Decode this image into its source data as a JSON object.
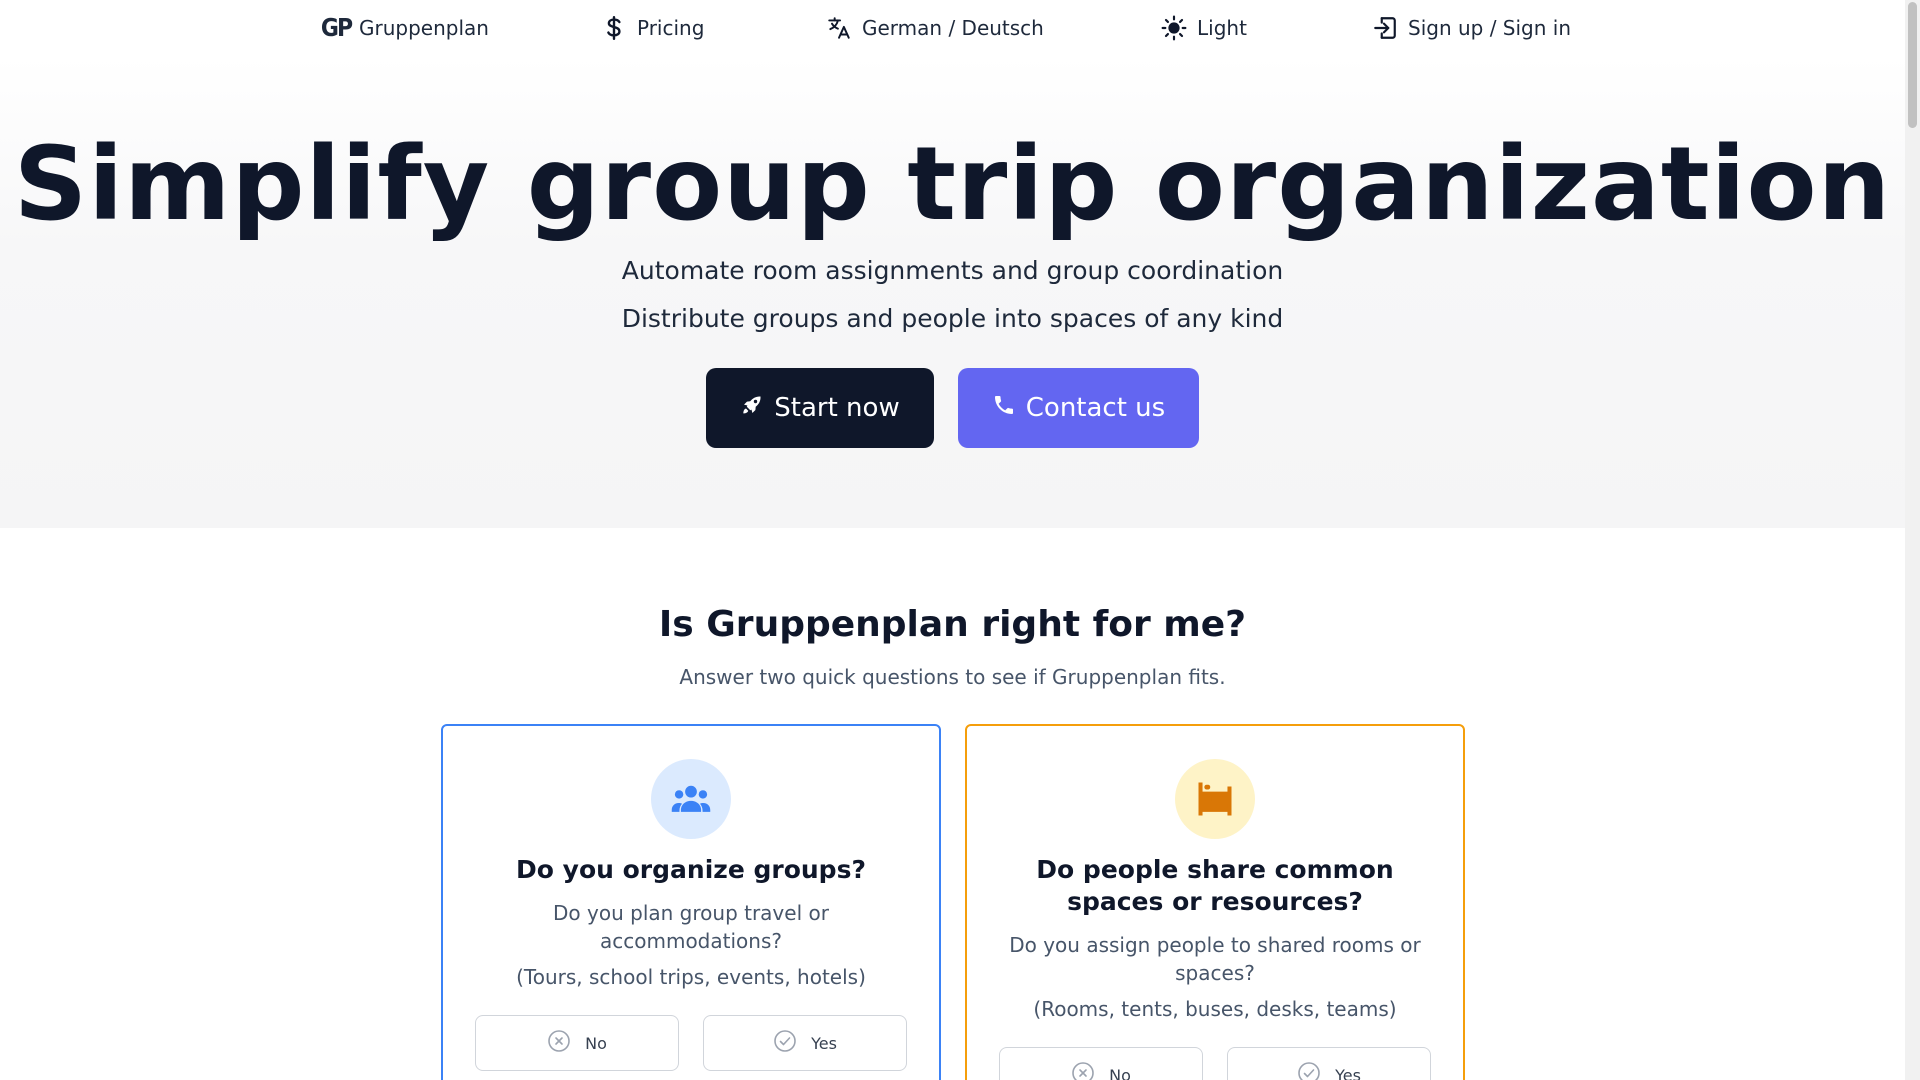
{
  "nav": {
    "brand": "Gruppenplan",
    "logo_mark": "GP",
    "pricing": "Pricing",
    "language": "German / Deutsch",
    "theme": "Light",
    "auth": "Sign up / Sign in"
  },
  "hero": {
    "title": "Simplify group trip organization",
    "subtitle_1": "Automate room assignments and group coordination",
    "subtitle_2": "Distribute groups and people into spaces of any kind",
    "start_label": "Start now",
    "contact_label": "Contact us"
  },
  "quiz": {
    "title": "Is Gruppenplan right for me?",
    "subtitle": "Answer two quick questions to see if Gruppenplan fits.",
    "cards": [
      {
        "icon": "group-icon",
        "title": "Do you organize groups?",
        "question": "Do you plan group travel or accommodations?",
        "examples": "(Tours, school trips, events, hotels)",
        "no_label": "No",
        "yes_label": "Yes",
        "accent": "#3b82f6"
      },
      {
        "icon": "bed-icon",
        "title": "Do people share common spaces or resources?",
        "question": "Do you assign people to shared rooms or spaces?",
        "examples": "(Rooms, tents, buses, desks, teams)",
        "no_label": "No",
        "yes_label": "Yes",
        "accent": "#f59e0b"
      }
    ]
  },
  "colors": {
    "primary_dark": "#0f172a",
    "accent_indigo": "#6366f1"
  }
}
